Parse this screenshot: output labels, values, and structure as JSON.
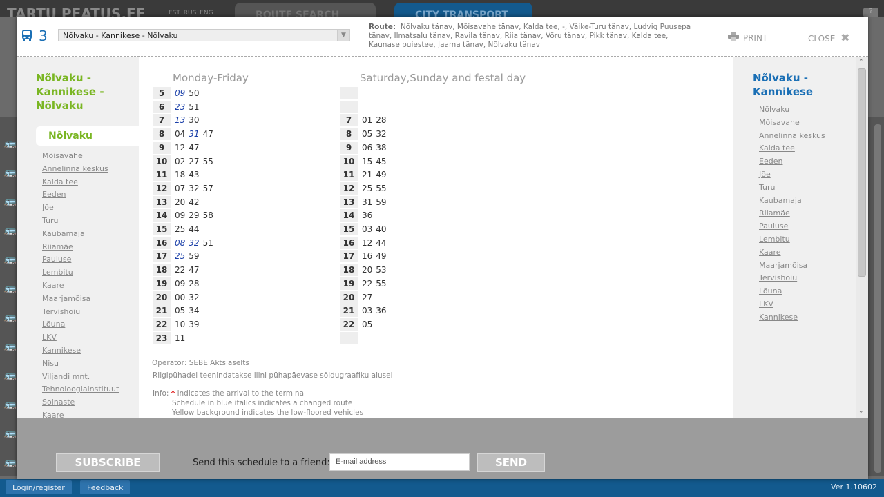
{
  "background": {
    "logo": "TARTU PEATUS.EE",
    "langs": "EST RUS ENG",
    "tab_route": "ROUTE SEARCH",
    "tab_city": "CITY TRANSPORT",
    "help": "?",
    "login": "Login/register",
    "feedback": "Feedback",
    "version": "Ver 1.10602"
  },
  "header": {
    "route_number": "3",
    "route_select": "Nõlvaku - Kannikese - Nõlvaku",
    "route_label": "Route:",
    "route_text": "Nõlvaku tänav, Mõisavahe tänav, Kalda tee, -, Väike-Turu tänav, Ludvig Puusepa tänav, Ilmatsalu tänav, Ravila tänav, Riia tänav, Võru tänav, Pikk tänav, Kalda tee, Kaunase puiestee, Jaama tänav, Nõlvaku tänav",
    "print": "PRINT",
    "close": "CLOSE"
  },
  "left": {
    "title": "Nõlvaku - Kannikese - Nõlvaku",
    "active_stop": "Nõlvaku",
    "stops": [
      "Mõisavahe",
      "Annelinna keskus",
      "Kalda tee",
      "Eeden",
      "Jõe",
      "Turu",
      "Kaubamaja",
      "Riiamäe",
      "Pauluse",
      "Lembitu",
      "Kaare",
      "Maarjamõisa",
      "Tervishoiu",
      "Lõuna",
      "LKV",
      "Kannikese",
      "Nisu",
      "Viljandi mnt.",
      "Tehnoloogiainstituut",
      "Soinaste",
      "Kaare"
    ]
  },
  "right": {
    "title": "Nõlvaku - Kannikese",
    "stops": [
      "Nõlvaku",
      "Mõisavahe",
      "Annelinna keskus",
      "Kalda tee",
      "Eeden",
      "Jõe",
      "Turu",
      "Kaubamaja",
      "Riiamäe",
      "Pauluse",
      "Lembitu",
      "Kaare",
      "Maarjamõisa",
      "Tervishoiu",
      "Lõuna",
      "LKV",
      "Kannikese"
    ]
  },
  "schedule": {
    "weekday_title": "Monday-Friday",
    "weekend_title": "Saturday,Sunday and festal day",
    "weekday": [
      {
        "h": "5",
        "m": [
          {
            "v": "09",
            "i": true
          },
          {
            "v": "50"
          }
        ]
      },
      {
        "h": "6",
        "m": [
          {
            "v": "23",
            "i": true
          },
          {
            "v": "51"
          }
        ]
      },
      {
        "h": "7",
        "m": [
          {
            "v": "13",
            "i": true
          },
          {
            "v": "30"
          }
        ]
      },
      {
        "h": "8",
        "m": [
          {
            "v": "04"
          },
          {
            "v": "31",
            "i": true
          },
          {
            "v": "47"
          }
        ]
      },
      {
        "h": "9",
        "m": [
          {
            "v": "12"
          },
          {
            "v": "47"
          }
        ]
      },
      {
        "h": "10",
        "m": [
          {
            "v": "02"
          },
          {
            "v": "27"
          },
          {
            "v": "55"
          }
        ]
      },
      {
        "h": "11",
        "m": [
          {
            "v": "18"
          },
          {
            "v": "43"
          }
        ]
      },
      {
        "h": "12",
        "m": [
          {
            "v": "07"
          },
          {
            "v": "32"
          },
          {
            "v": "57"
          }
        ]
      },
      {
        "h": "13",
        "m": [
          {
            "v": "20"
          },
          {
            "v": "42"
          }
        ]
      },
      {
        "h": "14",
        "m": [
          {
            "v": "09"
          },
          {
            "v": "29"
          },
          {
            "v": "58"
          }
        ]
      },
      {
        "h": "15",
        "m": [
          {
            "v": "25"
          },
          {
            "v": "44"
          }
        ]
      },
      {
        "h": "16",
        "m": [
          {
            "v": "08",
            "i": true
          },
          {
            "v": "32",
            "i": true
          },
          {
            "v": "51"
          }
        ]
      },
      {
        "h": "17",
        "m": [
          {
            "v": "25",
            "i": true
          },
          {
            "v": "59"
          }
        ]
      },
      {
        "h": "18",
        "m": [
          {
            "v": "22"
          },
          {
            "v": "47"
          }
        ]
      },
      {
        "h": "19",
        "m": [
          {
            "v": "09"
          },
          {
            "v": "28"
          }
        ]
      },
      {
        "h": "20",
        "m": [
          {
            "v": "00"
          },
          {
            "v": "32"
          }
        ]
      },
      {
        "h": "21",
        "m": [
          {
            "v": "05"
          },
          {
            "v": "34"
          }
        ]
      },
      {
        "h": "22",
        "m": [
          {
            "v": "10"
          },
          {
            "v": "39"
          }
        ]
      },
      {
        "h": "23",
        "m": [
          {
            "v": "11"
          }
        ]
      }
    ],
    "weekend": [
      {
        "h": "",
        "m": []
      },
      {
        "h": "",
        "m": []
      },
      {
        "h": "7",
        "m": [
          {
            "v": "01"
          },
          {
            "v": "28"
          }
        ]
      },
      {
        "h": "8",
        "m": [
          {
            "v": "05"
          },
          {
            "v": "32"
          }
        ]
      },
      {
        "h": "9",
        "m": [
          {
            "v": "06"
          },
          {
            "v": "38"
          }
        ]
      },
      {
        "h": "10",
        "m": [
          {
            "v": "15"
          },
          {
            "v": "45"
          }
        ]
      },
      {
        "h": "11",
        "m": [
          {
            "v": "21"
          },
          {
            "v": "49"
          }
        ]
      },
      {
        "h": "12",
        "m": [
          {
            "v": "25"
          },
          {
            "v": "55"
          }
        ]
      },
      {
        "h": "13",
        "m": [
          {
            "v": "31"
          },
          {
            "v": "59"
          }
        ]
      },
      {
        "h": "14",
        "m": [
          {
            "v": "36"
          }
        ]
      },
      {
        "h": "15",
        "m": [
          {
            "v": "03"
          },
          {
            "v": "40"
          }
        ]
      },
      {
        "h": "16",
        "m": [
          {
            "v": "12"
          },
          {
            "v": "44"
          }
        ]
      },
      {
        "h": "17",
        "m": [
          {
            "v": "16"
          },
          {
            "v": "49"
          }
        ]
      },
      {
        "h": "18",
        "m": [
          {
            "v": "20"
          },
          {
            "v": "53"
          }
        ]
      },
      {
        "h": "19",
        "m": [
          {
            "v": "22"
          },
          {
            "v": "55"
          }
        ]
      },
      {
        "h": "20",
        "m": [
          {
            "v": "27"
          }
        ]
      },
      {
        "h": "21",
        "m": [
          {
            "v": "03"
          },
          {
            "v": "36"
          }
        ]
      },
      {
        "h": "22",
        "m": [
          {
            "v": "05"
          }
        ]
      },
      {
        "h": "",
        "m": []
      }
    ],
    "operator": "Operator: SEBE Aktsiaselts",
    "note": "Riigipühadel teenindatakse liini pühapäevase sõidugraafiku alusel",
    "info_label": "Info:",
    "info_star": "*",
    "info_1": "indicates the arrival to the terminal",
    "info_2": "Schedule in blue italics indicates a changed route",
    "info_3": "Yellow background indicates the low-floored vehicles"
  },
  "footer": {
    "subscribe": "SUBSCRIBE",
    "send_label": "Send this schedule to a friend:",
    "email_placeholder": "E-mail address",
    "send": "SEND"
  },
  "colors": {
    "green_title": "#7ab623",
    "blue_title": "#1a6fb5",
    "changed_route": "#1a3fa8",
    "brand_bar": "#135a8e"
  }
}
